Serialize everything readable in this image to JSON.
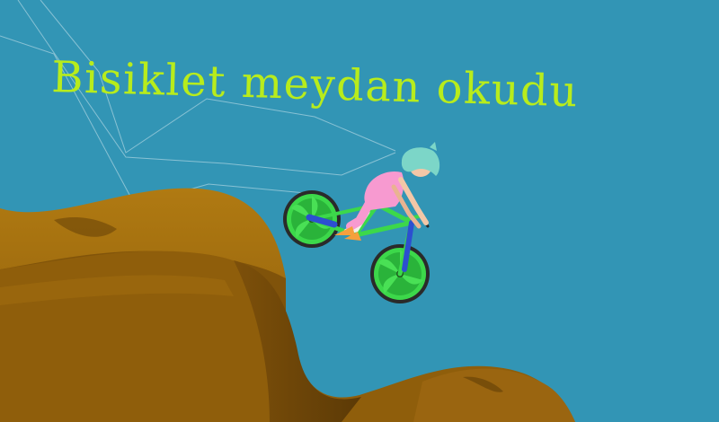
{
  "game": {
    "title": "Bisiklet meydan okudu"
  },
  "colors": {
    "sky": "#3295b5",
    "title": "#b8ec1c",
    "dirt_light": "#a6710f",
    "dirt_mid": "#8e5d0b",
    "dirt_dark": "#6a4408",
    "bike_frame": "#3cd84a",
    "wheel": "#3cd84a",
    "rider_shirt": "#f79ad0",
    "rider_hair": "#7cd6c8",
    "rider_shoes": "#f5a03c"
  },
  "icons": [
    "bicycle-icon",
    "rider-icon"
  ]
}
